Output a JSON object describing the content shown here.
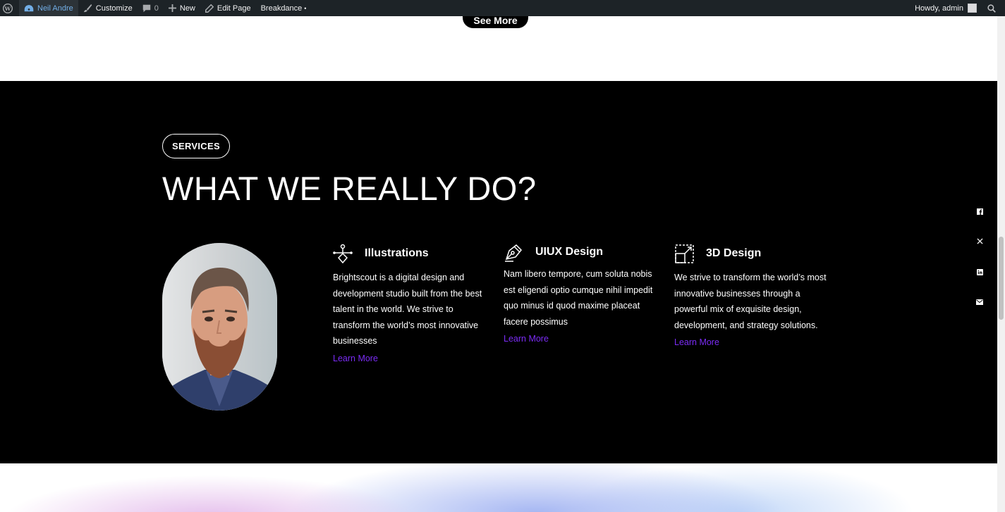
{
  "adminbar": {
    "site_name": "Neil Andre",
    "customize": "Customize",
    "comments_count": "0",
    "new": "New",
    "edit_page": "Edit Page",
    "breakdance": "Breakdance",
    "breakdance_dot": "•",
    "howdy": "Howdy, admin"
  },
  "top": {
    "see_more": "See More"
  },
  "services": {
    "pill": "SERVICES",
    "headline": "WHAT WE REALLY DO?",
    "items": [
      {
        "title": "Illustrations",
        "text": "Brightscout is a digital design and development studio built from the best talent in the world. We strive to transform the world’s most innovative businesses",
        "link": "Learn More",
        "icon": "pen-tool-icon"
      },
      {
        "title": "UIUX Design",
        "text": "Nam libero tempore, cum soluta nobis est eligendi optio cumque nihil impedit quo minus id quod maxime placeat facere possimus",
        "link": "Learn More",
        "icon": "fountain-pen-icon"
      },
      {
        "title": "3D Design",
        "text": "We strive to transform the world’s most innovative businesses through a powerful mix of exquisite design, development, and strategy solutions.",
        "link": "Learn More",
        "icon": "scale-box-icon"
      }
    ]
  },
  "social": [
    "facebook-icon",
    "x-icon",
    "linkedin-icon",
    "email-icon"
  ],
  "colors": {
    "accent": "#7b2cf5",
    "dark_bg": "#000000",
    "adminbar_bg": "#1d2327"
  }
}
